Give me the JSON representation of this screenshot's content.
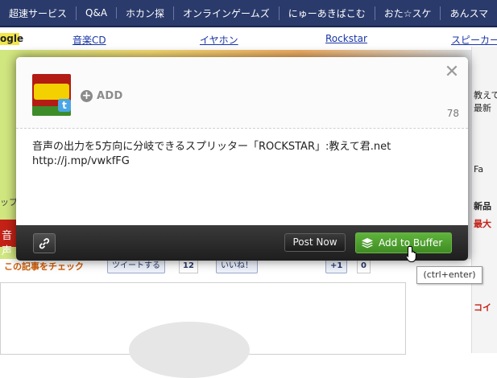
{
  "background": {
    "nav_items": [
      "超速サービス",
      "Q&A",
      "ホカン探",
      "オンラインゲームズ",
      "にゅーあきばこむ",
      "おた☆スケ",
      "あんスマ"
    ],
    "links": {
      "google": "ogle",
      "music": "音楽CD",
      "earphone": "イヤホン",
      "rockstar": "Rockstar",
      "speaker": "スピーカー"
    },
    "right_panel": {
      "line1": "教えて",
      "line2": "最新",
      "line3": "Fa",
      "line4": "新品",
      "line5": "最大",
      "line6": "コイ"
    },
    "left_text": "ップ",
    "red_block_text": "音声",
    "social": {
      "check_label": "この記事をチェック",
      "tweet_label": "ツイートする",
      "tweet_count": "12",
      "like_label": "いいね！",
      "plusone_label": "+1",
      "plusone_count": "0"
    }
  },
  "dialog": {
    "add_label": "ADD",
    "char_count": "78",
    "message": "音声の出力を5方向に分岐できるスプリッター「ROCKSTAR」:教えて君.net\nhttp://j.mp/vwkfFG",
    "post_now_label": "Post Now",
    "add_to_buffer_label": "Add to Buffer"
  },
  "tooltip": "(ctrl+enter)",
  "colors": {
    "nav_bg": "#2a3a6b",
    "buffer_green": "#4fa22f",
    "footer_dark": "#2a2a2a"
  }
}
